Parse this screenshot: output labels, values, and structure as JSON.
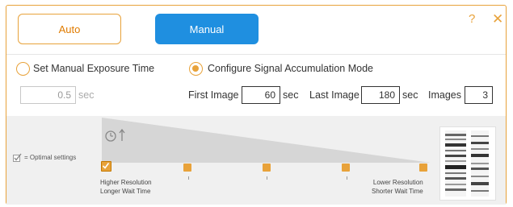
{
  "modes": {
    "auto_label": "Auto",
    "manual_label": "Manual",
    "selected": "Manual"
  },
  "header": {
    "help_glyph": "?",
    "close_glyph": "✕"
  },
  "exposure": {
    "set_manual_label": "Set Manual Exposure Time",
    "set_manual_selected": false,
    "value": "0.5",
    "unit": "sec"
  },
  "accumulation": {
    "label": "Configure Signal Accumulation Mode",
    "selected": true,
    "first_image_label": "First Image",
    "first_image_value": "60",
    "first_image_unit": "sec",
    "last_image_label": "Last Image",
    "last_image_value": "180",
    "last_image_unit": "sec",
    "images_label": "Images",
    "images_value": "3"
  },
  "timeline": {
    "optimal_legend": "= Optimal settings",
    "left_caption_1": "Higher Resolution",
    "left_caption_2": "Longer Wait Time",
    "right_caption_1": "Lower Resolution",
    "right_caption_2": "Shorter Wait Time",
    "marker_count": 5,
    "selected_marker": 1
  },
  "colors": {
    "accent": "#e8a23a",
    "primary": "#1f8fe0",
    "panel_bg": "#f0f0f0"
  },
  "icons": [
    "timer-icon",
    "up-arrow-icon",
    "check-icon",
    "help-icon",
    "close-icon",
    "gel-thumbnail"
  ]
}
